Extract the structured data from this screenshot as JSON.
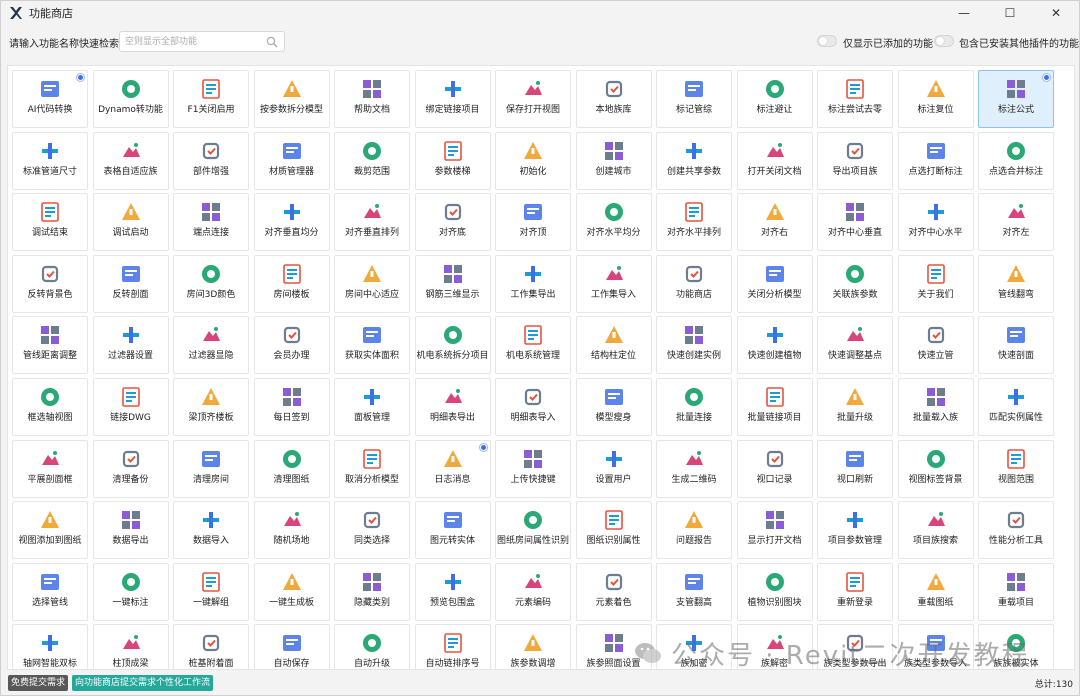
{
  "window": {
    "title": "功能商店",
    "minimize_glyph": "—",
    "maximize_glyph": "☐",
    "close_glyph": "✕"
  },
  "search": {
    "label": "请输入功能名称快速检索:",
    "placeholder": "空则显示全部功能",
    "value": ""
  },
  "filters": [
    {
      "label": "仅显示已添加的功能",
      "on": false
    },
    {
      "label": "包含已安装其他插件的功能",
      "on": false
    }
  ],
  "colors": {
    "accent": "#3f6fe8",
    "selected_bg": "#dfeffb",
    "teal_button": "#24a89a",
    "dark_button": "#585858"
  },
  "tiles": [
    {
      "label": "AI代码转换",
      "icon": "code-window-icon",
      "dot": true
    },
    {
      "label": "Dynamo转功能",
      "icon": "dynamo-icon"
    },
    {
      "label": "F1关闭启用",
      "icon": "f1-key-icon"
    },
    {
      "label": "按参数拆分模型",
      "icon": "grid-split-icon"
    },
    {
      "label": "帮助文档",
      "icon": "help-icon"
    },
    {
      "label": "绑定链接项目",
      "icon": "link-bind-icon"
    },
    {
      "label": "保存打开视图",
      "icon": "save-view-icon"
    },
    {
      "label": "本地族库",
      "icon": "family-library-icon"
    },
    {
      "label": "标记管综",
      "icon": "tag-pipe-icon"
    },
    {
      "label": "标注避让",
      "icon": "dimension-avoid-icon"
    },
    {
      "label": "标注尝试去零",
      "icon": "wave-icon"
    },
    {
      "label": "标注复位",
      "icon": "reset-line-icon"
    },
    {
      "label": "标注公式",
      "icon": "formula-icon",
      "dot": true,
      "selected": true
    },
    {
      "label": "标准管道尺寸",
      "icon": "compass-icon"
    },
    {
      "label": "表格自适应族",
      "icon": "excel-icon"
    },
    {
      "label": "部件增强",
      "icon": "box-open-icon"
    },
    {
      "label": "材质管理器",
      "icon": "material-icon"
    },
    {
      "label": "裁剪范围",
      "icon": "crop-icon"
    },
    {
      "label": "参数楼梯",
      "icon": "stairs-icon"
    },
    {
      "label": "初始化",
      "icon": "refresh-icon"
    },
    {
      "label": "创建城市",
      "icon": "city-icon"
    },
    {
      "label": "创建共享参数",
      "icon": "shared-param-icon"
    },
    {
      "label": "打开关闭文档",
      "icon": "open-close-doc-icon"
    },
    {
      "label": "导出项目族",
      "icon": "export-family-icon"
    },
    {
      "label": "点选打断标注",
      "icon": "break-dimension-icon"
    },
    {
      "label": "点选合并标注",
      "icon": "merge-dimension-icon"
    },
    {
      "label": "调试结束",
      "icon": "stop-icon"
    },
    {
      "label": "调试启动",
      "icon": "play-icon"
    },
    {
      "label": "端点连接",
      "icon": "endpoint-icon"
    },
    {
      "label": "对齐垂直均分",
      "icon": "align-vertical-distribute-icon"
    },
    {
      "label": "对齐垂直排列",
      "icon": "align-vertical-arrange-icon"
    },
    {
      "label": "对齐底",
      "icon": "align-bottom-icon"
    },
    {
      "label": "对齐顶",
      "icon": "align-top-icon"
    },
    {
      "label": "对齐水平均分",
      "icon": "align-horizontal-distribute-icon"
    },
    {
      "label": "对齐水平排列",
      "icon": "align-horizontal-arrange-icon"
    },
    {
      "label": "对齐右",
      "icon": "align-right-icon"
    },
    {
      "label": "对齐中心垂直",
      "icon": "align-center-vertical-icon"
    },
    {
      "label": "对齐中心水平",
      "icon": "align-center-horizontal-icon"
    },
    {
      "label": "对齐左",
      "icon": "align-left-icon"
    },
    {
      "label": "反转背景色",
      "icon": "paint-bucket-icon"
    },
    {
      "label": "反转剖面",
      "icon": "section-icon"
    },
    {
      "label": "房间3D颜色",
      "icon": "cube-3d-icon"
    },
    {
      "label": "房间楼板",
      "icon": "room-floor-icon"
    },
    {
      "label": "房间中心适应",
      "icon": "gear-ring-icon"
    },
    {
      "label": "钢筋三维显示",
      "icon": "rebar-icon"
    },
    {
      "label": "工作集导出",
      "icon": "export-hand-icon"
    },
    {
      "label": "工作集导入",
      "icon": "wrench-icon"
    },
    {
      "label": "功能商店",
      "icon": "gift-icon"
    },
    {
      "label": "关闭分析模型",
      "icon": "close-box-icon"
    },
    {
      "label": "关联族参数",
      "icon": "calculator-icon"
    },
    {
      "label": "关于我们",
      "icon": "info-icon"
    },
    {
      "label": "管线翻弯",
      "icon": "pipe-bend-icon"
    },
    {
      "label": "管线距离调整",
      "icon": "distance-icon"
    },
    {
      "label": "过滤器设置",
      "icon": "filter-icon"
    },
    {
      "label": "过滤器显隐",
      "icon": "eye-filter-icon"
    },
    {
      "label": "会员办理",
      "icon": "vip-icon"
    },
    {
      "label": "获取实体面积",
      "icon": "hatch-area-icon"
    },
    {
      "label": "机电系统拆分项目",
      "icon": "mep-split-icon"
    },
    {
      "label": "机电系统管理",
      "icon": "mep-manage-icon"
    },
    {
      "label": "结构柱定位",
      "icon": "column-grid-icon"
    },
    {
      "label": "快速创建实例",
      "icon": "hash-icon"
    },
    {
      "label": "快速创建植物",
      "icon": "plant-icon"
    },
    {
      "label": "快速调整基点",
      "icon": "base-point-icon"
    },
    {
      "label": "快速立管",
      "icon": "riser-icon"
    },
    {
      "label": "快速剖面",
      "icon": "quick-section-icon"
    },
    {
      "label": "框选轴视图",
      "icon": "axis-cube-icon"
    },
    {
      "label": "链接DWG",
      "icon": "dwg-icon"
    },
    {
      "label": "梁顶齐楼板",
      "icon": "beam-align-icon"
    },
    {
      "label": "每日签到",
      "icon": "signature-icon"
    },
    {
      "label": "面板管理",
      "icon": "panel-icon"
    },
    {
      "label": "明细表导出",
      "icon": "schedule-export-icon"
    },
    {
      "label": "明细表导入",
      "icon": "schedule-import-icon"
    },
    {
      "label": "模型瘦身",
      "icon": "broom-icon"
    },
    {
      "label": "批量连接",
      "icon": "pentagon-icon"
    },
    {
      "label": "批量链接项目",
      "icon": "batch-link-icon"
    },
    {
      "label": "批量升级",
      "icon": "batch-upgrade-icon"
    },
    {
      "label": "批量载入族",
      "icon": "layers-icon"
    },
    {
      "label": "匹配实例属性",
      "icon": "match-brush-icon"
    },
    {
      "label": "平展剖面框",
      "icon": "flat-cube-icon"
    },
    {
      "label": "清理备份",
      "icon": "clean-backup-icon"
    },
    {
      "label": "清理房间",
      "icon": "clean-room-icon"
    },
    {
      "label": "清理图纸",
      "icon": "clean-sheet-icon"
    },
    {
      "label": "取消分析模型",
      "icon": "cancel-gear-icon"
    },
    {
      "label": "日志消息",
      "icon": "log-icon",
      "dot": true
    },
    {
      "label": "上传快捷键",
      "icon": "keyboard-icon"
    },
    {
      "label": "设置用户",
      "icon": "user-set-icon"
    },
    {
      "label": "生成二维码",
      "icon": "qrcode-icon"
    },
    {
      "label": "视口记录",
      "icon": "viewport-record-icon"
    },
    {
      "label": "视口刷新",
      "icon": "viewport-refresh-icon"
    },
    {
      "label": "视图标签背景",
      "icon": "book-icon"
    },
    {
      "label": "视图范围",
      "icon": "view-range-icon"
    },
    {
      "label": "视图添加到图纸",
      "icon": "add-sheet-icon"
    },
    {
      "label": "数据导出",
      "icon": "data-export-icon"
    },
    {
      "label": "数据导入",
      "icon": "data-import-icon"
    },
    {
      "label": "随机场地",
      "icon": "mountain-icon"
    },
    {
      "label": "同类选择",
      "icon": "shapes-icon"
    },
    {
      "label": "图元转实体",
      "icon": "circles-icon"
    },
    {
      "label": "图纸房间属性识别",
      "icon": "scan-icon"
    },
    {
      "label": "图纸识别属性",
      "icon": "sheet-recognize-icon"
    },
    {
      "label": "问题报告",
      "icon": "report-icon"
    },
    {
      "label": "显示打开文档",
      "icon": "show-doc-icon"
    },
    {
      "label": "项目参数管理",
      "icon": "project-param-icon"
    },
    {
      "label": "项目族搜索",
      "icon": "family-search-icon"
    },
    {
      "label": "性能分析工具",
      "icon": "performance-icon"
    },
    {
      "label": "选择管线",
      "icon": "select-pipe-icon"
    },
    {
      "label": "一键标注",
      "icon": "ruler-icon"
    },
    {
      "label": "一键解组",
      "icon": "ungroup-icon"
    },
    {
      "label": "一键生成板",
      "icon": "generate-slab-icon"
    },
    {
      "label": "隐藏类别",
      "icon": "hide-eye-icon"
    },
    {
      "label": "预览包围盒",
      "icon": "bounding-box-icon"
    },
    {
      "label": "元素编码",
      "icon": "code-10-icon"
    },
    {
      "label": "元素着色",
      "icon": "palette-icon"
    },
    {
      "label": "支管翻高",
      "icon": "branch-raise-icon"
    },
    {
      "label": "植物识别图块",
      "icon": "tree-icon"
    },
    {
      "label": "重新登录",
      "icon": "relogin-icon"
    },
    {
      "label": "重载图纸",
      "icon": "reload-sheet-icon"
    },
    {
      "label": "重载项目",
      "icon": "reload-project-icon"
    },
    {
      "label": "轴网智能双标",
      "icon": "grid-dim-icon"
    },
    {
      "label": "柱顶成梁",
      "icon": "column-beam-icon"
    },
    {
      "label": "桩基附着面",
      "icon": "pile-icon"
    },
    {
      "label": "自动保存",
      "icon": "auto-save-icon"
    },
    {
      "label": "自动升级",
      "icon": "auto-upgrade-icon"
    },
    {
      "label": "自动链排序号",
      "icon": "braces-icon"
    },
    {
      "label": "族参数调增",
      "icon": "plus-box-icon"
    },
    {
      "label": "族参照面设置",
      "icon": "ref-plane-icon"
    },
    {
      "label": "族加密",
      "icon": "lock-icon"
    },
    {
      "label": "族解密",
      "icon": "unlock-icon"
    },
    {
      "label": "族类型参数导出",
      "icon": "type-export-icon"
    },
    {
      "label": "族类型参数导入",
      "icon": "type-import-icon"
    },
    {
      "label": "族族被实体",
      "icon": "family-entity-icon"
    }
  ],
  "status": {
    "free_request": "免费提交需求",
    "store_request": "向功能商店提交需求个性化工作流",
    "total": "总计:130"
  },
  "watermark": {
    "text": "公众号 · Revit二次开发教程"
  }
}
